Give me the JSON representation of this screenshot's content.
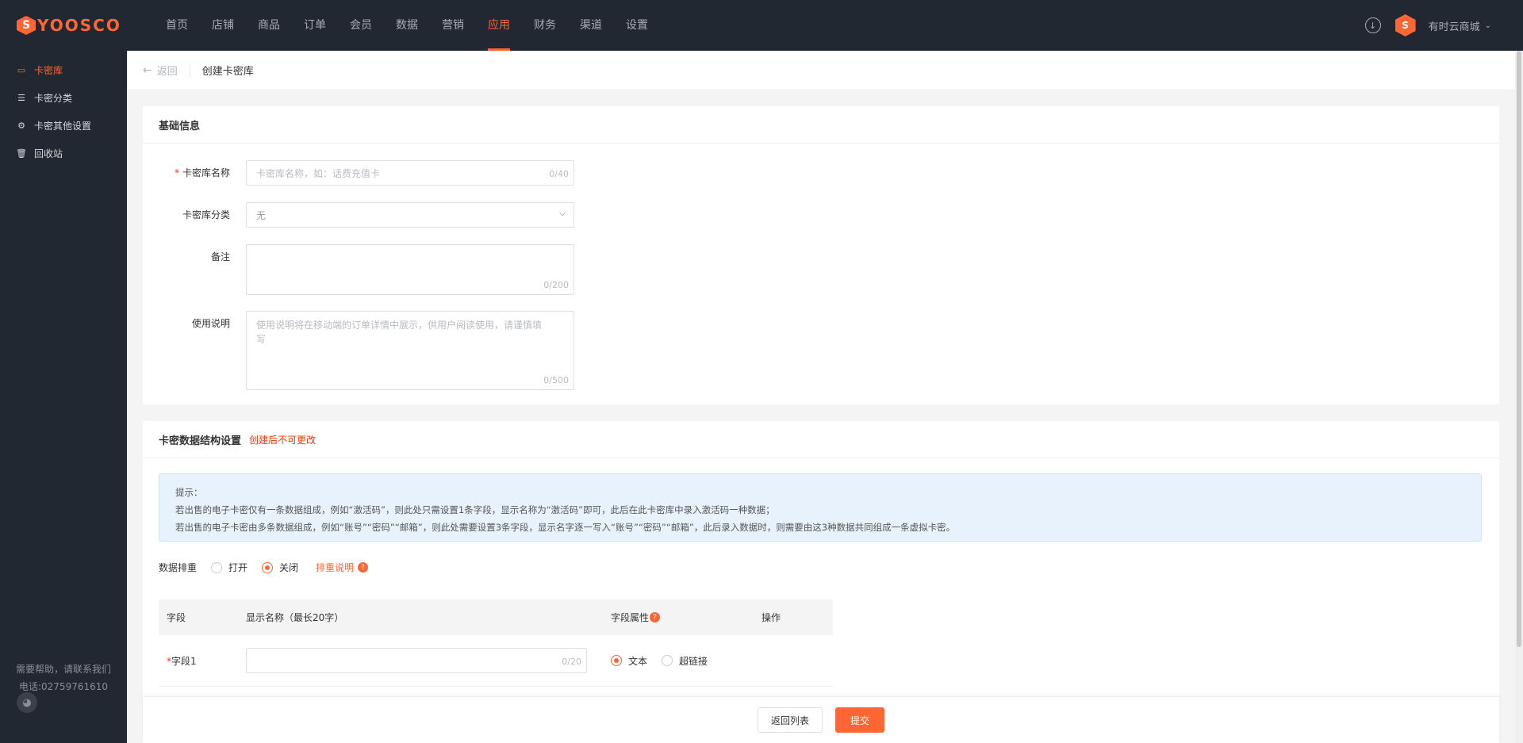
{
  "brand": {
    "mark": "S",
    "name": "YOOSCO"
  },
  "topnav": {
    "items": [
      "首页",
      "店铺",
      "商品",
      "订单",
      "会员",
      "数据",
      "营销",
      "应用",
      "财务",
      "渠道",
      "设置"
    ],
    "active": "应用"
  },
  "account": {
    "avatar": "S",
    "shop_name": "有时云商城"
  },
  "sidebar": {
    "items": [
      {
        "label": "卡密库",
        "icon": "card-icon"
      },
      {
        "label": "卡密分类",
        "icon": "category-icon"
      },
      {
        "label": "卡密其他设置",
        "icon": "gear-icon"
      },
      {
        "label": "回收站",
        "icon": "trash-icon"
      }
    ],
    "help_line1": "需要帮助，请联系我们",
    "help_line2": "电话:02759761610"
  },
  "header": {
    "back_label": "返回",
    "title": "创建卡密库"
  },
  "basic": {
    "title": "基础信息",
    "name_label": "卡密库名称",
    "name_placeholder": "卡密库名称，如：话费充值卡",
    "name_count": "0/40",
    "category_label": "卡密库分类",
    "category_value": "无",
    "remark_label": "备注",
    "remark_count": "0/200",
    "usage_label": "使用说明",
    "usage_placeholder": "使用说明将在移动端的订单详情中展示，供用户阅读使用，请谨慎填写",
    "usage_count": "0/500"
  },
  "structure": {
    "title": "卡密数据结构设置",
    "warning": "创建后不可更改",
    "tip_title": "提示：",
    "tip_line1": "若出售的电子卡密仅有一条数据组成，例如“激活码”，则此处只需设置1条字段，显示名称为“激活码”即可，此后在此卡密库中录入激活码一种数据；",
    "tip_line2": "若出售的电子卡密由多条数据组成，例如“账号”“密码”“邮箱”，则此处需要设置3条字段，显示名字逐一写入“账号”“密码”“邮箱”，此后录入数据时，则需要由这3种数据共同组成一条虚拟卡密。",
    "dedupe_label": "数据排重",
    "dedupe_on": "打开",
    "dedupe_off": "关闭",
    "dedupe_selected": "关闭",
    "dedupe_help": "排重说明",
    "table": {
      "headers": [
        "字段",
        "显示名称（最长20字）",
        "字段属性",
        "操作"
      ],
      "rows": [
        {
          "field": "字段1",
          "count": "0/20",
          "attr_text": "文本",
          "attr_link": "超链接",
          "selected": "文本"
        }
      ]
    }
  },
  "footer": {
    "back_list": "返回列表",
    "submit": "提交"
  },
  "colors": {
    "accent": "#ff6633",
    "nav_bg": "#222831",
    "warning": "#ff3300",
    "tip_bg": "#e8f2fd"
  }
}
